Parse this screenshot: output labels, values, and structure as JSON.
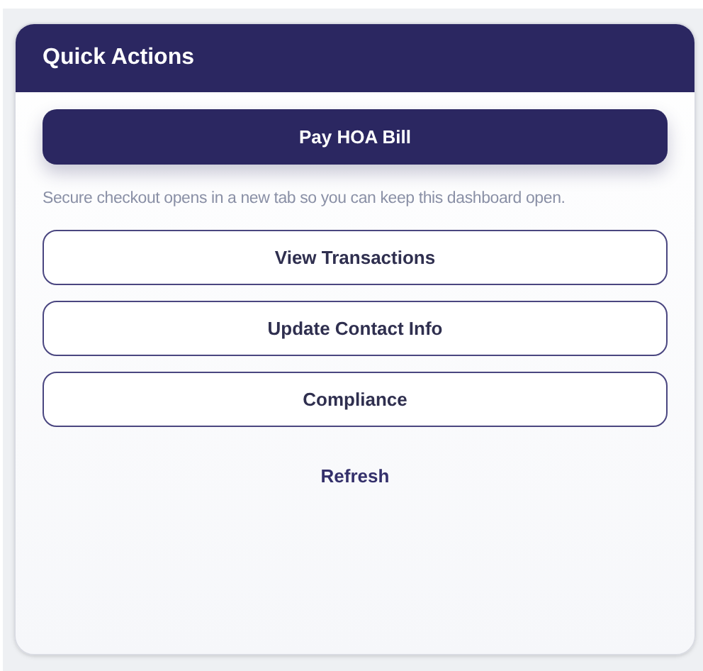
{
  "card": {
    "title": "Quick Actions"
  },
  "actions": [
    {
      "kind": "primary",
      "label": "Pay HOA Bill"
    },
    {
      "kind": "note",
      "label": "Secure checkout opens in a new tab so you can keep this dashboard open."
    },
    {
      "kind": "outline",
      "label": "View Transactions"
    },
    {
      "kind": "outline",
      "label": "Update Contact Info"
    },
    {
      "kind": "outline",
      "label": "Compliance"
    },
    {
      "kind": "text",
      "label": "Refresh"
    }
  ]
}
